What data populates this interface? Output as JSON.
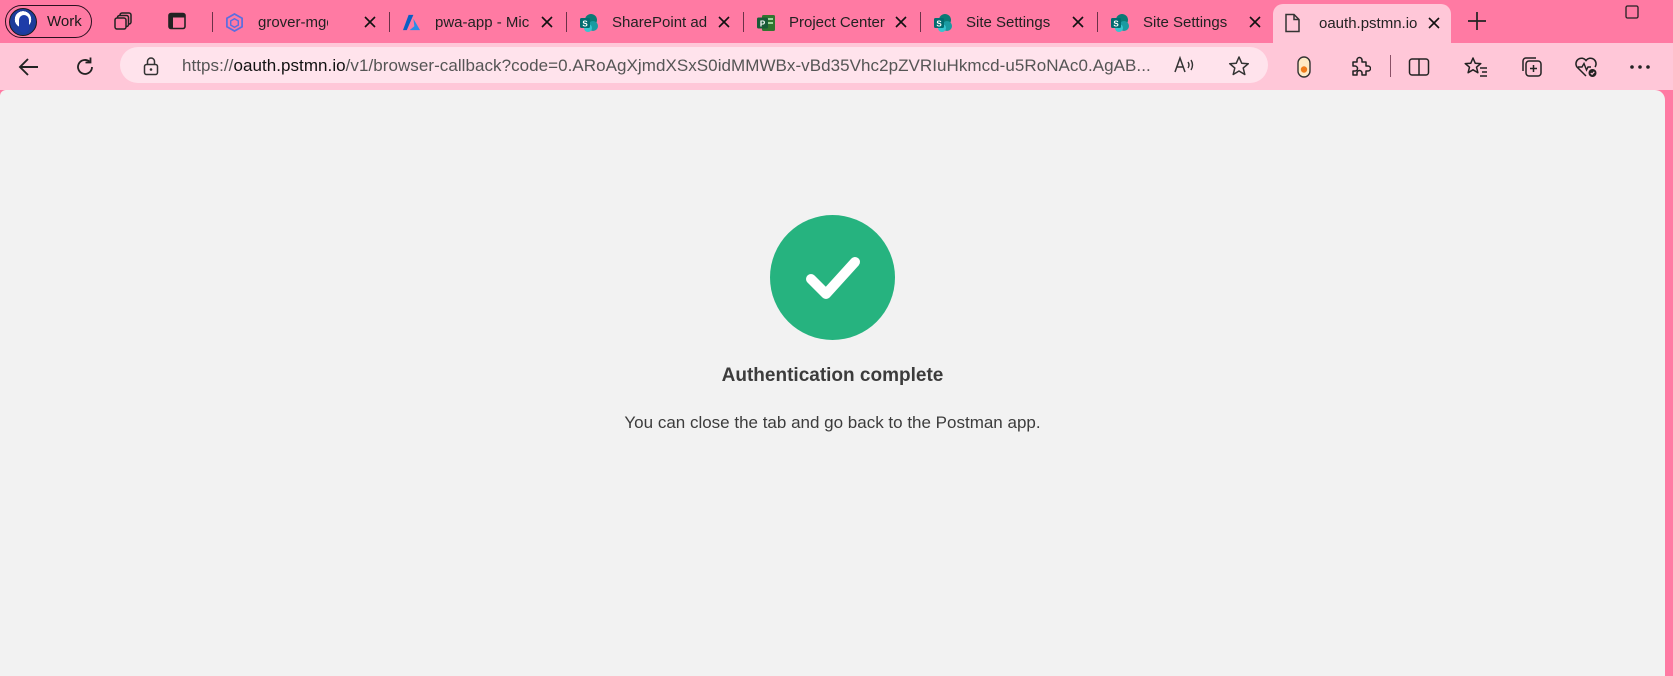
{
  "browser": {
    "profile": {
      "label": "Work"
    },
    "tabs": [
      {
        "title": "grover-mgdc -",
        "icon": "cube-icon"
      },
      {
        "title": "pwa-app - Mic",
        "icon": "azure-icon"
      },
      {
        "title": "SharePoint adr",
        "icon": "sharepoint-icon"
      },
      {
        "title": "Project Center",
        "icon": "project-icon"
      },
      {
        "title": "Site Settings",
        "icon": "sharepoint-icon"
      },
      {
        "title": "Site Settings",
        "icon": "sharepoint-icon"
      },
      {
        "title": "oauth.pstmn.io",
        "icon": "page-icon",
        "active": true
      }
    ],
    "address_bar": {
      "scheme": "https://",
      "host": "oauth.pstmn.io",
      "path": "/v1/browser-callback?code=0.ARoAgXjmdXSxS0idMMWBx-vBd35Vhc2pZVRIuHkmcd-u5RoNAc0.AgAB..."
    }
  },
  "page": {
    "heading": "Authentication complete",
    "message": "You can close the tab and go back to the Postman app.",
    "status_color": "#26b37f"
  },
  "theme": {
    "tabstrip_bg": "#ff7aa3",
    "toolbar_bg": "#ffc7d8",
    "content_bg": "#f2f2f2"
  }
}
